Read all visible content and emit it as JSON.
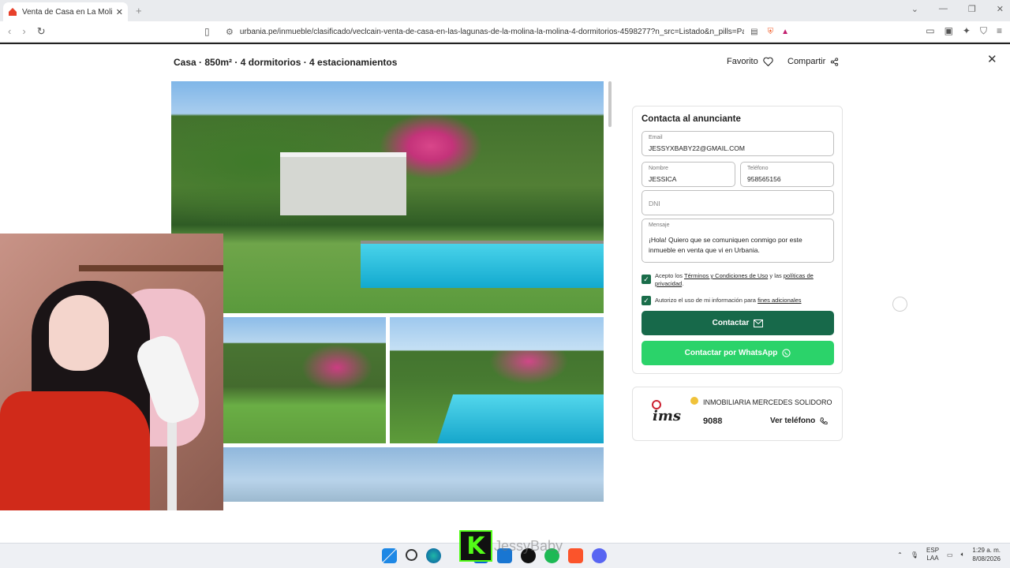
{
  "browser": {
    "tab_title": "Venta de Casa en La Molina - Lin",
    "url": "urbania.pe/inmueble/clasificado/veclcain-venta-de-casa-en-las-lagunas-de-la-molina-la-molina-4-dormitorios-4598277?n_src=Listado&n_pills=Parri..."
  },
  "header": {
    "headline": "Casa · 850m² · 4 dormitorios · 4 estacionamientos",
    "favorito": "Favorito",
    "compartir": "Compartir"
  },
  "contact_form": {
    "title": "Contacta al anunciante",
    "email_label": "Email",
    "email_value": "JESSYXBABY22@GMAIL.COM",
    "nombre_label": "Nombre",
    "nombre_value": "JESSICA",
    "telefono_label": "Teléfono",
    "telefono_value": "958565156",
    "dni_placeholder": "DNI",
    "mensaje_label": "Mensaje",
    "mensaje_value": "¡Hola! Quiero que se comuniquen conmigo por este inmueble en venta que vi en Urbania.",
    "terms_prefix": "Acepto los ",
    "terms_link": "Términos y Condiciones de Uso",
    "terms_middle": " y las ",
    "privacy_link": "políticas de privacidad",
    "terms_suffix": ".",
    "autorizo_prefix": "Autorizo el uso de mi información para ",
    "autorizo_link": "fines adicionales",
    "contact_button": "Contactar",
    "whatsapp_button": "Contactar por WhatsApp"
  },
  "agent": {
    "logo_text": "ims",
    "name": "INMOBILIARIA MERCEDES SOLIDORO",
    "phone_partial": "9088",
    "ver_telefono": "Ver teléfono"
  },
  "overlay": {
    "streamer_name": "JessyBaby"
  },
  "taskbar": {
    "lang_top": "ESP",
    "lang_bottom": "LAA",
    "time": "1:29 a. m.",
    "date": "8/08/2026"
  },
  "colors": {
    "primary_green": "#17694a",
    "whatsapp_green": "#2bd36a",
    "kick_green": "#53fc18"
  }
}
